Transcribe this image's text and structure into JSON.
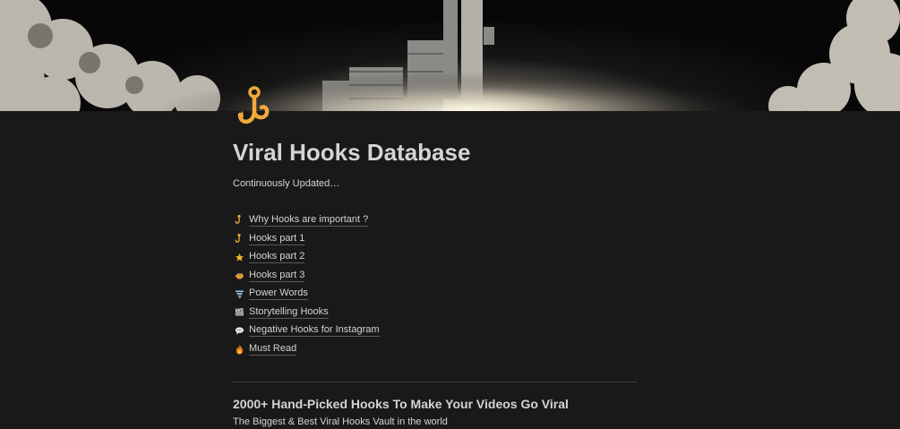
{
  "page": {
    "title": "Viral Hooks Database",
    "subtitle": "Continuously Updated…",
    "icon": "hook-icon"
  },
  "cover": {
    "image": "space-shuttle-launch-at-night"
  },
  "links": [
    {
      "icon": "hook-icon",
      "label": "Why Hooks are important ?"
    },
    {
      "icon": "hook-icon",
      "label": "Hooks part 1"
    },
    {
      "icon": "star-icon",
      "label": "Hooks part 2"
    },
    {
      "icon": "bowl-icon",
      "label": "Hooks part 3"
    },
    {
      "icon": "tornado-icon",
      "label": "Power Words"
    },
    {
      "icon": "clapperboard-icon",
      "label": "Storytelling Hooks"
    },
    {
      "icon": "speech-bubble-icon",
      "label": "Negative Hooks for Instagram"
    },
    {
      "icon": "fire-icon",
      "label": "Must Read"
    }
  ],
  "section": {
    "heading": "2000+ Hand-Picked Hooks To Make Your Videos Go Viral",
    "subheading": "The Biggest & Best Viral Hooks Vault in the world"
  },
  "colors": {
    "background": "#191919",
    "text": "#d4d4d4",
    "hook": "#f2a93b"
  }
}
